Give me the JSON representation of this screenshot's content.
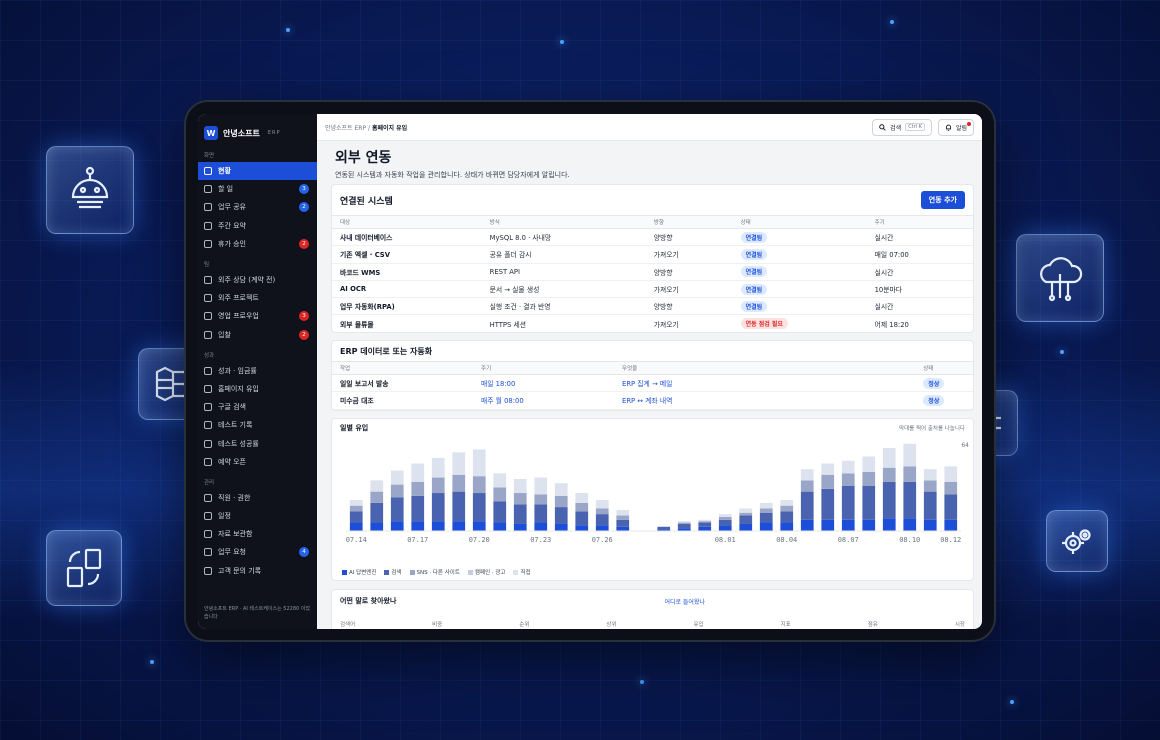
{
  "sidebar": {
    "brand": "안녕소프트",
    "brand_sub": "ERP",
    "section_home": "화면",
    "section_team": "팀",
    "section_growth": "성과",
    "section_admin": "관리",
    "items": [
      {
        "label": "현황",
        "badge": ""
      },
      {
        "label": "할 일",
        "badge": "3"
      },
      {
        "label": "업무 공유",
        "badge": "2"
      },
      {
        "label": "주간 요약",
        "badge": ""
      },
      {
        "label": "휴가 승인",
        "badge": "2"
      },
      {
        "label": "외주 상담 (계약 전)",
        "badge": ""
      },
      {
        "label": "외주 프로젝트",
        "badge": ""
      },
      {
        "label": "영업 프로우업",
        "badge": "3"
      },
      {
        "label": "입찰",
        "badge": "2"
      },
      {
        "label": "성과 · 임금률",
        "badge": ""
      },
      {
        "label": "홈페이지 유입",
        "badge": ""
      },
      {
        "label": "구글 검색",
        "badge": ""
      },
      {
        "label": "테스트 기록",
        "badge": ""
      },
      {
        "label": "테스트 성공률",
        "badge": ""
      },
      {
        "label": "예약 오픈",
        "badge": ""
      },
      {
        "label": "직원 · 권한",
        "badge": ""
      },
      {
        "label": "일정",
        "badge": ""
      },
      {
        "label": "자료 보관함",
        "badge": ""
      },
      {
        "label": "업무 요청",
        "badge": "4"
      },
      {
        "label": "고객 문의 기록",
        "badge": ""
      }
    ],
    "footer": "안녕소프트 ERP · AI 테스트케이스는 52280 이었습니다"
  },
  "topbar": {
    "breadcrumb_root": "안녕소프트 ERP /",
    "breadcrumb_current": "홈페이지 유입",
    "search_label": "검색",
    "search_kbd": "Ctrl K",
    "alert_label": "알림"
  },
  "page": {
    "title": "외부 연동",
    "subtitle": "연동된 시스템과 자동화 작업을 관리합니다. 상태가 바뀌면 담당자에게 알립니다."
  },
  "systems": {
    "title": "연결된 시스템",
    "add_button": "연동 추가",
    "headers": [
      "대상",
      "방식",
      "방향",
      "상태",
      "주기"
    ],
    "rows": [
      {
        "target": "사내 데이터베이스",
        "method": "MySQL 8.0 · 사내망",
        "direction": "양방향",
        "status": "연결됨",
        "warn": false,
        "cycle": "실시간"
      },
      {
        "target": "기존 엑셀 · CSV",
        "method": "공유 폴더 감시",
        "direction": "가져오기",
        "status": "연결됨",
        "warn": false,
        "cycle": "매일 07:00"
      },
      {
        "target": "바코드 WMS",
        "method": "REST API",
        "direction": "양방향",
        "status": "연결됨",
        "warn": false,
        "cycle": "실시간"
      },
      {
        "target": "AI OCR",
        "method": "문서 → 실물 생성",
        "direction": "가져오기",
        "status": "연결됨",
        "warn": false,
        "cycle": "10분마다"
      },
      {
        "target": "업무 자동화(RPA)",
        "method": "실행 조건 · 결과 반영",
        "direction": "양방향",
        "status": "연결됨",
        "warn": false,
        "cycle": "실시간"
      },
      {
        "target": "외부 물류몰",
        "method": "HTTPS 세션",
        "direction": "가져오기",
        "status": "연동 점검 필요",
        "warn": true,
        "cycle": "어제 18:20"
      }
    ]
  },
  "automation": {
    "title": "ERP 데이터로 또는 자동화",
    "headers": [
      "작업",
      "주기",
      "무엇을",
      "상태"
    ],
    "rows": [
      {
        "task": "일일 보고서 발송",
        "cycle": "매일 18:00",
        "what": "ERP 집계 → 메일",
        "status": "정상"
      },
      {
        "task": "미수금 대조",
        "cycle": "매주 월 08:00",
        "what": "ERP ↔ 계좌 내역",
        "status": "정상"
      }
    ]
  },
  "chart_card": {
    "title": "일별 유입",
    "hint": "막대를 찍어 출처를 나눕니다"
  },
  "chart_data": {
    "type": "bar",
    "stacked": true,
    "ylim": [
      0,
      64
    ],
    "yticks": [
      "64"
    ],
    "categories": [
      "07.14",
      "07.15",
      "07.16",
      "07.17",
      "07.18",
      "07.19",
      "07.20",
      "07.21",
      "07.22",
      "07.23",
      "07.24",
      "07.25",
      "07.26",
      "07.27",
      "07.28",
      "07.29",
      "07.30",
      "07.31",
      "08.01",
      "08.02",
      "08.03",
      "08.04",
      "08.05",
      "08.06",
      "08.07",
      "08.08",
      "08.09",
      "08.10",
      "08.11",
      "08.12"
    ],
    "xlabels": [
      "07.14",
      "07.17",
      "07.20",
      "07.23",
      "07.26",
      "08.01",
      "08.04",
      "08.07",
      "08.10",
      "08.12"
    ],
    "series": [
      {
        "name": "AI 답변엔진",
        "color": "#1d4ed8",
        "values": [
          6,
          6,
          7,
          7,
          7,
          7,
          7,
          6,
          5,
          6,
          5,
          4,
          4,
          3,
          0,
          1,
          2,
          3,
          4,
          5,
          6,
          6,
          8,
          8,
          8,
          8,
          9,
          9,
          8,
          8
        ]
      },
      {
        "name": "검색",
        "color": "#4a63b0",
        "values": [
          8,
          14,
          17,
          18,
          20,
          21,
          20,
          15,
          14,
          13,
          12,
          10,
          8,
          5,
          0,
          2,
          3,
          3,
          4,
          6,
          7,
          8,
          20,
          22,
          24,
          24,
          26,
          26,
          20,
          18
        ]
      },
      {
        "name": "SNS · 다른 사이트",
        "color": "#9aa6c8",
        "values": [
          4,
          8,
          9,
          10,
          11,
          12,
          12,
          10,
          8,
          7,
          8,
          6,
          4,
          3,
          0,
          0,
          1,
          1,
          2,
          2,
          3,
          4,
          8,
          10,
          9,
          10,
          10,
          11,
          8,
          9
        ]
      },
      {
        "name": "캠페인 · 광고",
        "color": "#c5cde0",
        "values": [
          0,
          0,
          0,
          0,
          0,
          0,
          0,
          0,
          0,
          0,
          0,
          0,
          0,
          0,
          0,
          0,
          0,
          0,
          0,
          0,
          0,
          0,
          0,
          0,
          0,
          0,
          0,
          0,
          0,
          0
        ]
      },
      {
        "name": "직접",
        "color": "#dde3ee",
        "values": [
          4,
          8,
          10,
          13,
          14,
          16,
          19,
          10,
          10,
          12,
          9,
          7,
          6,
          4,
          0,
          0,
          1,
          1,
          2,
          3,
          4,
          4,
          8,
          8,
          9,
          11,
          14,
          16,
          8,
          11
        ]
      }
    ]
  },
  "bottom_card": {
    "title": "어떤 말로 찾아왔나",
    "link": "어디로 들어왔나",
    "headers": [
      "검색어",
      "비중",
      "순위",
      "상위",
      "유입",
      "지표",
      "점유",
      "시장"
    ]
  }
}
